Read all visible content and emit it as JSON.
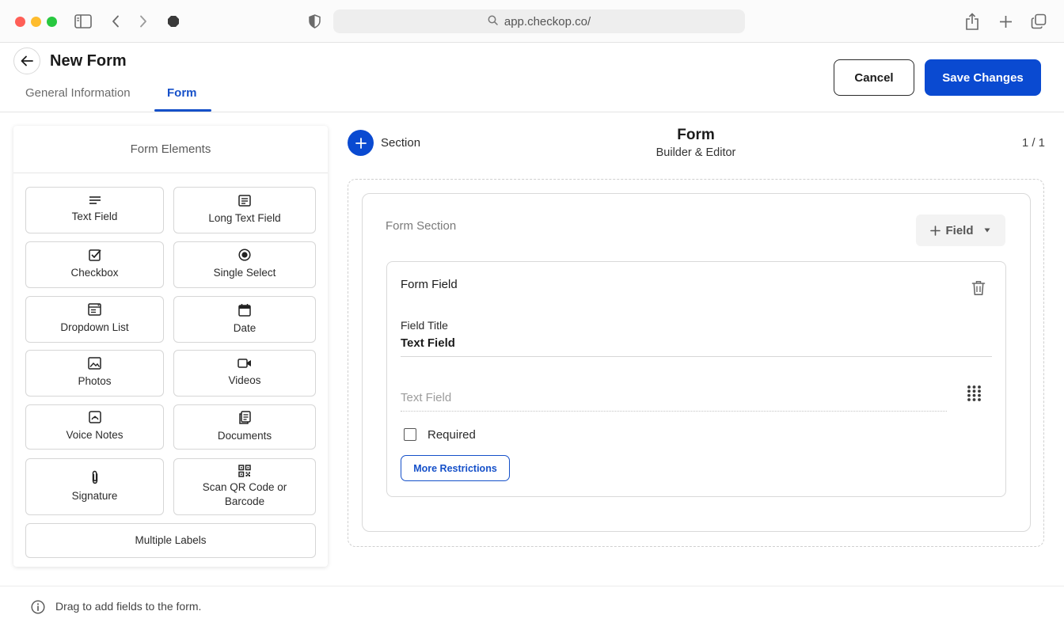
{
  "browser": {
    "url": "app.checkop.co/",
    "traffic_colors": [
      "#ff5f57",
      "#febc2e",
      "#28c840"
    ]
  },
  "header": {
    "title": "New Form",
    "tabs": [
      {
        "label": "General Information",
        "active": false
      },
      {
        "label": "Form",
        "active": true
      }
    ],
    "cancel_label": "Cancel",
    "save_label": "Save Changes"
  },
  "elements_panel": {
    "title": "Form Elements",
    "items": [
      {
        "label": "Text Field",
        "icon": "text-lines-icon"
      },
      {
        "label": "Long Text Field",
        "icon": "long-text-icon"
      },
      {
        "label": "Checkbox",
        "icon": "checkbox-icon"
      },
      {
        "label": "Single Select",
        "icon": "radio-icon"
      },
      {
        "label": "Dropdown List",
        "icon": "dropdown-list-icon"
      },
      {
        "label": "Date",
        "icon": "calendar-icon"
      },
      {
        "label": "Photos",
        "icon": "image-icon"
      },
      {
        "label": "Videos",
        "icon": "video-camera-icon"
      },
      {
        "label": "Voice Notes",
        "icon": "voice-note-icon"
      },
      {
        "label": "Documents",
        "icon": "document-icon"
      },
      {
        "label": "Signature",
        "icon": "paperclip-icon"
      },
      {
        "label": "Scan QR Code or Barcode",
        "icon": "qr-code-icon"
      },
      {
        "label": "Multiple Labels",
        "icon": ""
      }
    ]
  },
  "builder": {
    "section_button_label": "Section",
    "title": "Form",
    "subtitle": "Builder & Editor",
    "page_indicator": "1 / 1",
    "section": {
      "label": "Form Section",
      "add_field_label": "Field",
      "field": {
        "heading": "Form Field",
        "title_label": "Field Title",
        "title_value": "Text Field",
        "input_placeholder": "Text Field",
        "required_label": "Required",
        "required_checked": false,
        "more_restrictions_label": "More Restrictions"
      }
    }
  },
  "footer": {
    "hint": "Drag to add fields to the form."
  },
  "colors": {
    "primary": "#0a4ad1",
    "tab_active": "#1550c9"
  }
}
